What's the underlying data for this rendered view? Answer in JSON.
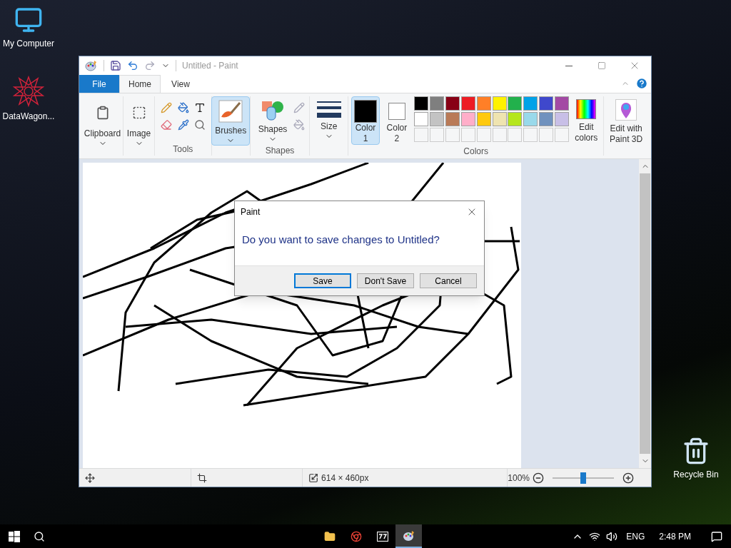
{
  "desktop_icons": [
    {
      "kind": "computer",
      "label": "My Computer"
    },
    {
      "kind": "shortcut",
      "label": "DataWagon..."
    },
    {
      "kind": "recycle",
      "label": "Recycle Bin"
    }
  ],
  "window": {
    "title": "Untitled - Paint"
  },
  "tabs": [
    {
      "label": "File",
      "kind": "app",
      "selected": false
    },
    {
      "label": "Home",
      "kind": "tab",
      "selected": true
    },
    {
      "label": "View",
      "kind": "tab",
      "selected": false
    }
  ],
  "ribbon": {
    "clipboard": "Clipboard",
    "image": "Image",
    "tools_label": "Tools",
    "brushes": {
      "label": "Brushes",
      "selected": true
    },
    "shapes": "Shapes",
    "shapes_label": "Shapes",
    "size": "Size",
    "color1": {
      "label": "Color",
      "number": "1",
      "selected": true
    },
    "color2": {
      "label": "Color",
      "number": "2",
      "selected": false
    },
    "palette": [
      {
        "color": "#000000"
      },
      {
        "color": "#7f7f7f"
      },
      {
        "color": "#880015"
      },
      {
        "color": "#ed1c24"
      },
      {
        "color": "#ff7f27"
      },
      {
        "color": "#fff200"
      },
      {
        "color": "#22b14c"
      },
      {
        "color": "#00a2e8"
      },
      {
        "color": "#3f48cc"
      },
      {
        "color": "#a349a4"
      },
      {
        "color": "#ffffff"
      },
      {
        "color": "#c3c3c3"
      },
      {
        "color": "#b97a57"
      },
      {
        "color": "#ffaec9"
      },
      {
        "color": "#ffc90e"
      },
      {
        "color": "#efe4b0"
      },
      {
        "color": "#b5e61d"
      },
      {
        "color": "#99d9ea"
      },
      {
        "color": "#7092be"
      },
      {
        "color": "#c8bfe7"
      }
    ],
    "edit_colors": [
      "Edit",
      "colors"
    ],
    "colors_label": "Colors",
    "paint3d": [
      "Edit with",
      "Paint 3D"
    ]
  },
  "status": {
    "dimensions": "614 × 460px",
    "zoom": "100%",
    "level": 0.5
  },
  "dialog": {
    "title": "Paint",
    "message": "Do you want to save changes to Untitled?",
    "buttons": [
      {
        "label": "Save",
        "default": true
      },
      {
        "label": "Don't Save",
        "default": false
      },
      {
        "label": "Cancel",
        "default": false
      }
    ]
  },
  "taskbar": {
    "apps": [
      {
        "kind": "folder",
        "active": false
      },
      {
        "kind": "browser",
        "active": false
      },
      {
        "kind": "archive",
        "active": false
      },
      {
        "kind": "paint",
        "active": true
      }
    ],
    "language": "ENG",
    "time": "2:48 PM"
  }
}
